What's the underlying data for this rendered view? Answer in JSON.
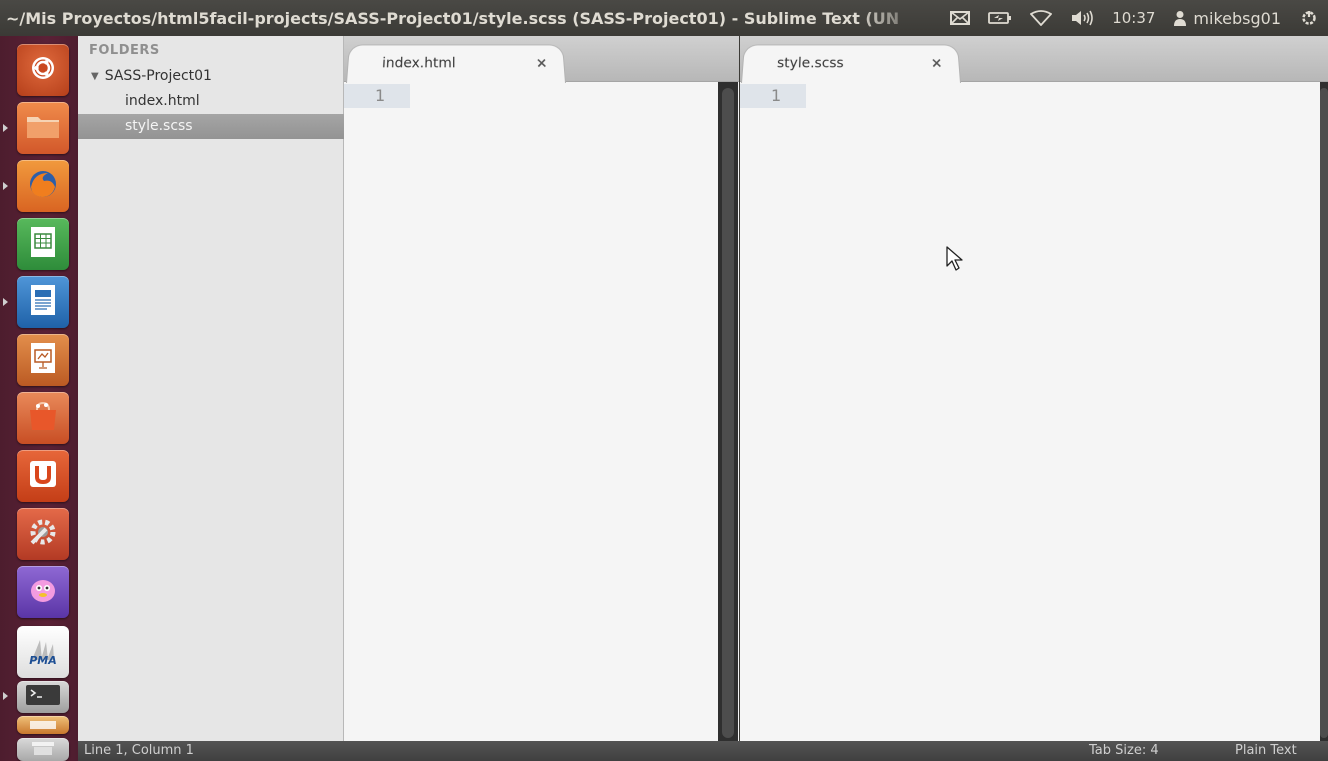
{
  "window": {
    "title": "~/Mis Proyectos/html5facil-projects/SASS-Project01/style.scss (SASS-Project01) - Sublime Text (UN"
  },
  "indicators": {
    "mail_icon": "envelope-icon",
    "battery_icon": "battery-charging-icon",
    "network_icon": "wifi-icon",
    "volume_icon": "volume-icon",
    "clock": "10:37",
    "user_icon": "person-icon",
    "user": "mikebsg01",
    "session_icon": "power-gear-icon"
  },
  "launcher": {
    "items": [
      {
        "name": "Dash",
        "icon": "ubuntu-logo-icon",
        "color": "#d5532b"
      },
      {
        "name": "Files",
        "icon": "folder-icon",
        "color": "#e07338"
      },
      {
        "name": "Firefox",
        "icon": "firefox-icon",
        "color": "#e77425"
      },
      {
        "name": "LibreOffice Calc",
        "icon": "spreadsheet-icon",
        "color": "#3fa64a"
      },
      {
        "name": "LibreOffice Writer",
        "icon": "document-icon",
        "color": "#2a7ac2"
      },
      {
        "name": "LibreOffice Impress",
        "icon": "presentation-icon",
        "color": "#d4732a"
      },
      {
        "name": "Software Center",
        "icon": "shopping-bag-icon",
        "color": "#e8602b"
      },
      {
        "name": "Ubuntu One",
        "icon": "ubuntu-one-icon",
        "color": "#dc4a1f"
      },
      {
        "name": "System Settings",
        "icon": "settings-wrench-icon",
        "color": "#d0452b"
      },
      {
        "name": "Pidgin",
        "icon": "pidgin-icon",
        "color": "#7b4fc4"
      },
      {
        "name": "phpMyAdmin",
        "icon": "pma-icon",
        "color": "#f0f0f0",
        "label": "PMA"
      },
      {
        "name": "Terminal",
        "icon": "terminal-icon",
        "color": "#a6a6a6"
      },
      {
        "name": "Workspaces",
        "icon": "workspace-icon",
        "color": "#8d8d8d"
      }
    ]
  },
  "sidebar": {
    "heading": "FOLDERS",
    "project": "SASS-Project01",
    "files": [
      "index.html",
      "style.scss"
    ],
    "selected": "style.scss"
  },
  "panes": [
    {
      "tab_label": "index.html",
      "close": "×",
      "line_number": "1"
    },
    {
      "tab_label": "style.scss",
      "close": "×",
      "line_number": "1"
    }
  ],
  "statusbar": {
    "position": "Line 1, Column 1",
    "tab_size": "Tab Size: 4",
    "syntax": "Plain Text"
  }
}
